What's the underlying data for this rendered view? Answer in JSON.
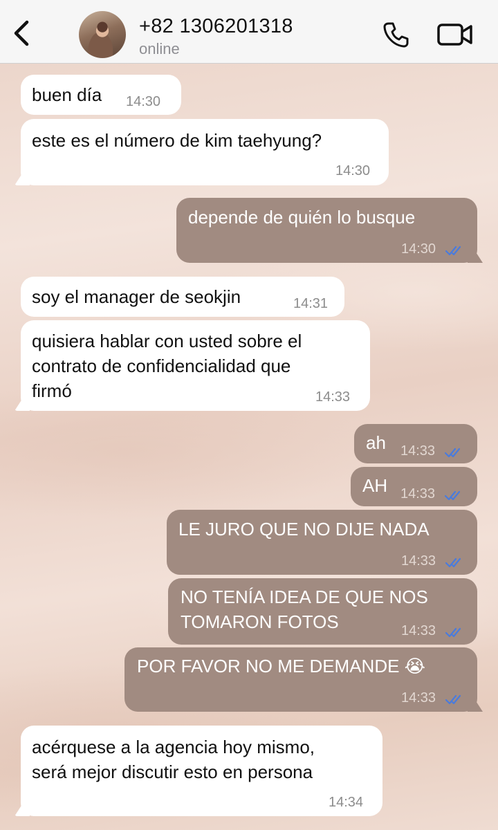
{
  "header": {
    "contact_name": "+82 1306201318",
    "status": "online"
  },
  "colors": {
    "incoming_bubble": "#ffffff",
    "outgoing_bubble": "#a18b81",
    "read_ticks": "#4a7bdc"
  },
  "icons": [
    "back-chevron-icon",
    "phone-icon",
    "video-camera-icon",
    "double-check-icon"
  ],
  "messages": [
    {
      "direction": "incoming",
      "text": "buen día",
      "time": "14:30"
    },
    {
      "direction": "incoming",
      "text": "este es el número de kim taehyung?",
      "time": "14:30"
    },
    {
      "direction": "outgoing",
      "text": "depende de quién lo busque",
      "time": "14:30",
      "status": "read"
    },
    {
      "direction": "incoming",
      "text": "soy el manager de seokjin",
      "time": "14:31"
    },
    {
      "direction": "incoming",
      "text": "quisiera hablar con usted sobre el\ncontrato de confidencialidad que\nfirmó",
      "time": "14:33"
    },
    {
      "direction": "outgoing",
      "text": "ah",
      "time": "14:33",
      "status": "read"
    },
    {
      "direction": "outgoing",
      "text": "AH",
      "time": "14:33",
      "status": "read"
    },
    {
      "direction": "outgoing",
      "text": "LE JURO QUE NO DIJE NADA",
      "time": "14:33",
      "status": "read"
    },
    {
      "direction": "outgoing",
      "text": "NO TENÍA IDEA DE QUE NOS\nTOMARON FOTOS",
      "time": "14:33",
      "status": "read"
    },
    {
      "direction": "outgoing",
      "text": "POR FAVOR NO ME DEMANDE 😭",
      "time": "14:33",
      "status": "read"
    },
    {
      "direction": "incoming",
      "text": "acérquese a la agencia hoy mismo,\nserá mejor discutir esto en persona",
      "time": "14:34"
    }
  ]
}
